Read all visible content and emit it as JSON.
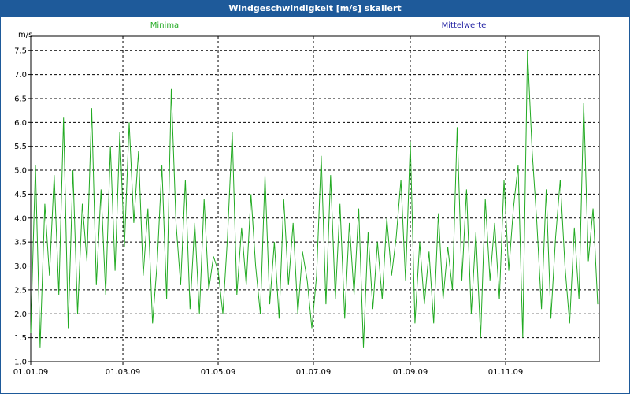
{
  "window": {
    "title": "Windgeschwindigkeit [m/s] skaliert"
  },
  "legend": [
    {
      "label": "Minima",
      "color": "#22aa22"
    },
    {
      "label": "Mittelwerte",
      "color": "#1a1aa0"
    }
  ],
  "chart_data": {
    "type": "line",
    "title": "Windgeschwindigkeit [m/s] skaliert",
    "ylabel": "m/s",
    "xlabel": "",
    "ylim": [
      1.0,
      7.8
    ],
    "yticks": [
      1.0,
      1.5,
      2.0,
      2.5,
      3.0,
      3.5,
      4.0,
      4.5,
      5.0,
      5.5,
      6.0,
      6.5,
      7.0,
      7.5
    ],
    "ytick_labels": [
      "1.0",
      "1.5",
      "2.0",
      "2.5",
      "3.0",
      "3.5",
      "4.0",
      "4.5",
      "5.0",
      "5.5",
      "6.0",
      "6.5",
      "7.0",
      "7.5"
    ],
    "xlim": [
      "2009-01-01",
      "2009-12-31"
    ],
    "xticks": [
      "2009-01-01",
      "2009-03-01",
      "2009-05-01",
      "2009-07-01",
      "2009-09-01",
      "2009-11-01"
    ],
    "xtick_labels": [
      "01.01.09",
      "01.03.09",
      "01.05.09",
      "01.07.09",
      "01.09.09",
      "01.11.09"
    ],
    "grid": true,
    "legend_position": "top",
    "series": [
      {
        "name": "Minima",
        "color": "#22aa22",
        "x": [
          "2009-01-01",
          "2009-01-04",
          "2009-01-07",
          "2009-01-10",
          "2009-01-13",
          "2009-01-16",
          "2009-01-19",
          "2009-01-22",
          "2009-01-25",
          "2009-01-28",
          "2009-01-31",
          "2009-02-03",
          "2009-02-06",
          "2009-02-09",
          "2009-02-12",
          "2009-02-15",
          "2009-02-18",
          "2009-02-21",
          "2009-02-24",
          "2009-02-27",
          "2009-03-02",
          "2009-03-05",
          "2009-03-08",
          "2009-03-11",
          "2009-03-14",
          "2009-03-17",
          "2009-03-20",
          "2009-03-23",
          "2009-03-26",
          "2009-03-29",
          "2009-04-01",
          "2009-04-04",
          "2009-04-07",
          "2009-04-10",
          "2009-04-13",
          "2009-04-16",
          "2009-04-19",
          "2009-04-22",
          "2009-04-25",
          "2009-04-28",
          "2009-05-01",
          "2009-05-04",
          "2009-05-07",
          "2009-05-10",
          "2009-05-13",
          "2009-05-16",
          "2009-05-19",
          "2009-05-22",
          "2009-05-25",
          "2009-05-28",
          "2009-05-31",
          "2009-06-03",
          "2009-06-06",
          "2009-06-09",
          "2009-06-12",
          "2009-06-15",
          "2009-06-18",
          "2009-06-21",
          "2009-06-24",
          "2009-06-27",
          "2009-06-30",
          "2009-07-03",
          "2009-07-06",
          "2009-07-09",
          "2009-07-12",
          "2009-07-15",
          "2009-07-18",
          "2009-07-21",
          "2009-07-24",
          "2009-07-27",
          "2009-07-30",
          "2009-08-02",
          "2009-08-05",
          "2009-08-08",
          "2009-08-11",
          "2009-08-14",
          "2009-08-17",
          "2009-08-20",
          "2009-08-23",
          "2009-08-26",
          "2009-08-29",
          "2009-09-01",
          "2009-09-04",
          "2009-09-07",
          "2009-09-10",
          "2009-09-13",
          "2009-09-16",
          "2009-09-19",
          "2009-09-22",
          "2009-09-25",
          "2009-09-28",
          "2009-10-01",
          "2009-10-04",
          "2009-10-07",
          "2009-10-10",
          "2009-10-13",
          "2009-10-16",
          "2009-10-19",
          "2009-10-22",
          "2009-10-25",
          "2009-10-28",
          "2009-10-31",
          "2009-11-03",
          "2009-11-06",
          "2009-11-09",
          "2009-11-12",
          "2009-11-15",
          "2009-11-18",
          "2009-11-21",
          "2009-11-24",
          "2009-11-27",
          "2009-11-30",
          "2009-12-03",
          "2009-12-06",
          "2009-12-09",
          "2009-12-12",
          "2009-12-15",
          "2009-12-18",
          "2009-12-21",
          "2009-12-24",
          "2009-12-27",
          "2009-12-30"
        ],
        "values": [
          1.6,
          5.1,
          1.3,
          4.3,
          2.8,
          4.9,
          2.4,
          6.1,
          1.7,
          5.0,
          2.0,
          4.3,
          3.1,
          6.3,
          2.6,
          4.6,
          2.4,
          5.5,
          2.9,
          5.8,
          3.4,
          6.0,
          3.9,
          5.4,
          2.8,
          4.2,
          1.8,
          3.1,
          5.1,
          2.3,
          6.7,
          3.9,
          2.6,
          4.8,
          2.1,
          3.9,
          2.0,
          4.4,
          2.5,
          3.2,
          2.9,
          2.0,
          3.6,
          5.8,
          2.4,
          3.8,
          2.6,
          4.5,
          3.0,
          2.0,
          4.9,
          2.2,
          3.5,
          1.9,
          4.4,
          2.6,
          3.9,
          2.0,
          3.3,
          2.7,
          1.7,
          2.8,
          5.3,
          2.2,
          4.9,
          2.3,
          4.3,
          1.9,
          3.9,
          2.4,
          4.2,
          1.3,
          3.7,
          2.1,
          3.5,
          2.3,
          4.0,
          2.8,
          3.6,
          4.8,
          2.7,
          5.6,
          1.8,
          3.5,
          2.2,
          3.3,
          1.8,
          4.1,
          2.3,
          3.4,
          2.5,
          5.9,
          2.7,
          4.6,
          2.0,
          3.7,
          1.5,
          4.4,
          2.7,
          3.9,
          2.3,
          4.8,
          2.9,
          4.2,
          5.1,
          1.5,
          7.5,
          5.4,
          3.9,
          2.1,
          4.6,
          1.9,
          3.6,
          4.8,
          3.0,
          1.8,
          3.8,
          2.3,
          6.4,
          3.1,
          4.2,
          2.2
        ]
      },
      {
        "name": "Mittelwerte",
        "color": "#1a1aa0",
        "x": [],
        "values": []
      }
    ]
  }
}
